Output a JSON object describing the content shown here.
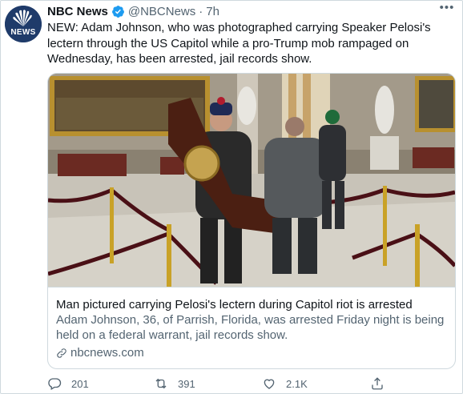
{
  "tweet": {
    "author_name": "NBC News",
    "author_handle": "@NBCNews",
    "separator": "·",
    "time": "7h",
    "avatar_text": "NEWS",
    "body": "NEW: Adam Johnson, who was photographed carrying Speaker Pelosi's lectern through the US Capitol while a pro-Trump mob rampaged on Wednesday, has been arrested, jail records show."
  },
  "card": {
    "title": "Man pictured carrying Pelosi's lectern during Capitol riot is arrested",
    "description": "Adam Johnson, 36, of Parrish, Florida, was arrested Friday night is being held on a federal warrant, jail records show.",
    "domain": "nbcnews.com"
  },
  "actions": {
    "replies": "201",
    "retweets": "391",
    "likes": "2.1K"
  },
  "colors": {
    "text": "#0f1419",
    "secondary": "#536471",
    "border": "#cfd9de",
    "verified": "#1d9bf0"
  },
  "icons": [
    "nbc-peacock-icon",
    "verified-badge-icon",
    "more-icon",
    "link-icon",
    "reply-icon",
    "retweet-icon",
    "like-icon",
    "share-icon"
  ]
}
